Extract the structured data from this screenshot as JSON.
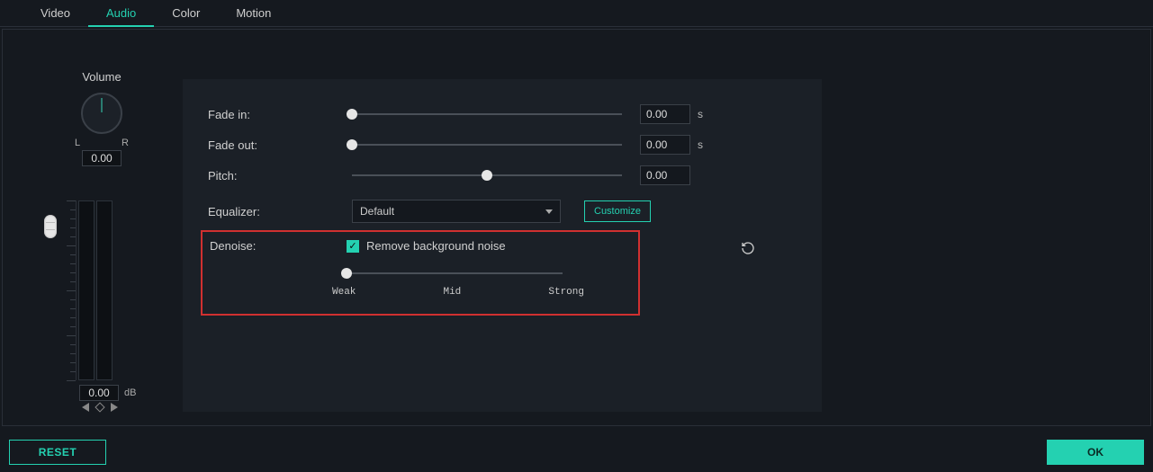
{
  "tabs": {
    "video": "Video",
    "audio": "Audio",
    "color": "Color",
    "motion": "Motion",
    "active": "audio"
  },
  "volume": {
    "title": "Volume",
    "left_mark": "L",
    "right_mark": "R",
    "pan_value": "0.00",
    "db_value": "0.00",
    "db_unit": "dB"
  },
  "settings": {
    "fade_in_label": "Fade in:",
    "fade_in_value": "0.00",
    "fade_in_unit": "s",
    "fade_out_label": "Fade out:",
    "fade_out_value": "0.00",
    "fade_out_unit": "s",
    "pitch_label": "Pitch:",
    "pitch_value": "0.00",
    "equalizer_label": "Equalizer:",
    "equalizer_selected": "Default",
    "customize_label": "Customize"
  },
  "denoise": {
    "label": "Denoise:",
    "checkbox_label": "Remove background noise",
    "checked": true,
    "weak": "Weak",
    "mid": "Mid",
    "strong": "Strong"
  },
  "buttons": {
    "reset": "RESET",
    "ok": "OK"
  }
}
